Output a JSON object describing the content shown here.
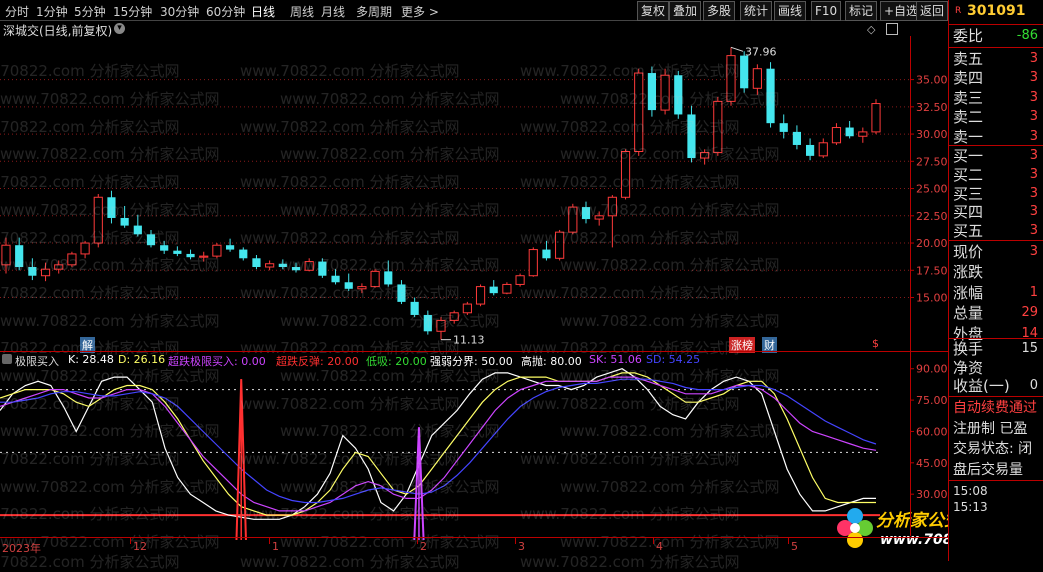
{
  "toolbar": {
    "periods": [
      "分时",
      "1分钟",
      "5分钟",
      "15分钟",
      "30分钟",
      "60分钟",
      "日线",
      "周线",
      "月线",
      "多周期",
      "更多 >"
    ],
    "active": "日线",
    "right_buttons": [
      "复权",
      "叠加",
      "多股",
      "统计",
      "画线",
      "F10",
      "标记",
      "+自选",
      "返回"
    ]
  },
  "stock": {
    "title": "深城交(日线,前复权)",
    "code": "301091",
    "high_label": "37.96",
    "low_label": "11.13",
    "tags": [
      "解",
      "涨榜",
      "财",
      "$"
    ]
  },
  "right_panel": {
    "wei_bi": {
      "label": "委比",
      "value": "-86"
    },
    "sell": [
      {
        "label": "卖五",
        "value": "3"
      },
      {
        "label": "卖四",
        "value": "3"
      },
      {
        "label": "卖三",
        "value": "3"
      },
      {
        "label": "卖二",
        "value": "3"
      },
      {
        "label": "卖一",
        "value": "3"
      }
    ],
    "buy": [
      {
        "label": "买一",
        "value": "3"
      },
      {
        "label": "买二",
        "value": "3"
      },
      {
        "label": "买三",
        "value": "3"
      },
      {
        "label": "买四",
        "value": "3"
      },
      {
        "label": "买五",
        "value": "3"
      }
    ],
    "quote": [
      {
        "label": "现价",
        "value": "3"
      },
      {
        "label": "涨跌",
        "value": ""
      },
      {
        "label": "涨幅",
        "value": "1"
      },
      {
        "label": "总量",
        "value": "29"
      },
      {
        "label": "外盘",
        "value": "14"
      }
    ],
    "extra": [
      {
        "label": "换手",
        "value": "15"
      },
      {
        "label": "净资",
        "value": ""
      },
      {
        "label": "收益(一)",
        "value": "0"
      }
    ],
    "notice": [
      "自动续费通过",
      "注册制 已盈",
      "交易状态: 闭",
      "盘后交易量"
    ],
    "times": [
      "15:08",
      "15:13"
    ]
  },
  "indicator": {
    "name": "极限买入",
    "values": [
      {
        "label": "K: 28.48",
        "color": "#ffffff"
      },
      {
        "label": "D: 26.16",
        "color": "#ffff66"
      },
      {
        "label": "超跌极限买入: 0.00",
        "color": "#cc44ff"
      },
      {
        "label": "超跌反弹: 20.00",
        "color": "#ff3030"
      },
      {
        "label": "低吸: 20.00",
        "color": "#33dd33"
      },
      {
        "label": "强弱分界: 50.00",
        "color": "#ffffff"
      },
      {
        "label": "高抛: 80.00",
        "color": "#ffffff"
      },
      {
        "label": "SK: 51.06",
        "color": "#cc44ff"
      },
      {
        "label": "SD: 54.25",
        "color": "#4444ff"
      }
    ]
  },
  "chart_data": [
    {
      "type": "candlestick",
      "title": "深城交(日线,前复权)",
      "y_ticks": [
        "35.00",
        "32.50",
        "30.00",
        "27.50",
        "25.00",
        "22.50",
        "20.00",
        "17.50",
        "15.00"
      ],
      "ylim": [
        10.0,
        39.0
      ],
      "annotations": [
        {
          "text": "37.96",
          "value": 37.96
        },
        {
          "text": "11.13",
          "value": 11.13
        }
      ],
      "ohlc": [
        [
          18.0,
          20.5,
          17.2,
          19.8
        ],
        [
          19.8,
          20.5,
          17.5,
          17.8
        ],
        [
          17.8,
          18.6,
          16.6,
          17.0
        ],
        [
          17.0,
          18.2,
          16.5,
          17.6
        ],
        [
          17.6,
          18.4,
          17.2,
          18.0
        ],
        [
          18.0,
          19.2,
          17.8,
          19.0
        ],
        [
          19.0,
          20.2,
          18.6,
          20.0
        ],
        [
          20.0,
          24.5,
          19.6,
          24.2
        ],
        [
          24.2,
          24.8,
          21.8,
          22.3
        ],
        [
          22.3,
          23.4,
          21.4,
          21.6
        ],
        [
          21.6,
          22.6,
          20.6,
          20.8
        ],
        [
          20.8,
          21.2,
          19.6,
          19.8
        ],
        [
          19.8,
          20.2,
          19.0,
          19.3
        ],
        [
          19.3,
          19.7,
          18.8,
          19.0
        ],
        [
          19.0,
          19.4,
          18.5,
          18.7
        ],
        [
          18.7,
          19.2,
          18.3,
          18.8
        ],
        [
          18.8,
          20.0,
          18.6,
          19.8
        ],
        [
          19.8,
          20.4,
          19.2,
          19.4
        ],
        [
          19.4,
          19.6,
          18.4,
          18.6
        ],
        [
          18.6,
          18.9,
          17.6,
          17.8
        ],
        [
          17.8,
          18.4,
          17.5,
          18.1
        ],
        [
          18.1,
          18.5,
          17.6,
          17.8
        ],
        [
          17.8,
          18.2,
          17.3,
          17.5
        ],
        [
          17.5,
          18.6,
          17.4,
          18.3
        ],
        [
          18.3,
          18.6,
          16.8,
          17.0
        ],
        [
          17.0,
          17.6,
          16.2,
          16.4
        ],
        [
          16.4,
          17.2,
          15.6,
          15.8
        ],
        [
          15.8,
          16.3,
          15.4,
          16.0
        ],
        [
          16.0,
          17.6,
          15.9,
          17.4
        ],
        [
          17.4,
          18.4,
          16.0,
          16.2
        ],
        [
          16.2,
          16.6,
          14.4,
          14.6
        ],
        [
          14.6,
          15.0,
          13.2,
          13.4
        ],
        [
          13.4,
          13.8,
          11.6,
          11.9
        ],
        [
          11.9,
          13.2,
          11.13,
          12.9
        ],
        [
          12.9,
          13.8,
          12.6,
          13.6
        ],
        [
          13.6,
          14.6,
          13.4,
          14.4
        ],
        [
          14.4,
          16.2,
          14.2,
          16.0
        ],
        [
          16.0,
          16.6,
          15.2,
          15.4
        ],
        [
          15.4,
          16.4,
          15.3,
          16.2
        ],
        [
          16.2,
          17.2,
          16.0,
          17.0
        ],
        [
          17.0,
          19.6,
          16.9,
          19.4
        ],
        [
          19.4,
          20.2,
          18.4,
          18.6
        ],
        [
          18.6,
          21.2,
          18.4,
          21.0
        ],
        [
          21.0,
          23.6,
          20.8,
          23.3
        ],
        [
          23.3,
          23.8,
          21.8,
          22.2
        ],
        [
          22.2,
          22.9,
          21.6,
          22.5
        ],
        [
          22.5,
          24.4,
          19.6,
          24.2
        ],
        [
          24.2,
          28.6,
          24.0,
          28.4
        ],
        [
          28.4,
          36.0,
          28.0,
          35.6
        ],
        [
          35.6,
          36.2,
          31.6,
          32.2
        ],
        [
          32.2,
          36.0,
          31.8,
          35.4
        ],
        [
          35.4,
          35.8,
          31.4,
          31.8
        ],
        [
          31.8,
          32.6,
          27.4,
          27.8
        ],
        [
          27.8,
          28.6,
          27.2,
          28.3
        ],
        [
          28.3,
          33.4,
          28.0,
          33.0
        ],
        [
          33.0,
          37.96,
          32.6,
          37.2
        ],
        [
          37.2,
          37.6,
          33.8,
          34.2
        ],
        [
          34.2,
          36.4,
          33.6,
          36.0
        ],
        [
          36.0,
          36.6,
          30.6,
          31.0
        ],
        [
          31.0,
          31.8,
          29.6,
          30.2
        ],
        [
          30.2,
          30.8,
          28.6,
          29.0
        ],
        [
          29.0,
          29.6,
          27.6,
          28.0
        ],
        [
          28.0,
          29.6,
          27.8,
          29.2
        ],
        [
          29.2,
          31.0,
          29.0,
          30.6
        ],
        [
          30.6,
          31.2,
          29.6,
          29.8
        ],
        [
          29.8,
          30.6,
          29.2,
          30.2
        ],
        [
          30.2,
          33.2,
          30.0,
          32.8
        ]
      ],
      "date_labels": [
        "2023年",
        "12",
        "1",
        "2",
        "3",
        "4",
        "5"
      ]
    },
    {
      "type": "line",
      "title": "极限买入",
      "y_ticks": [
        "90.00",
        "75.00",
        "60.00",
        "45.00",
        "30.00"
      ],
      "ylim": [
        10,
        98
      ],
      "levels": [
        {
          "name": "高抛",
          "value": 80
        },
        {
          "name": "强弱分界",
          "value": 50
        },
        {
          "name": "超跌反弹",
          "value": 20
        }
      ],
      "series": [
        {
          "name": "K",
          "color": "#ffffff",
          "values": [
            70,
            78,
            82,
            84,
            82,
            72,
            60,
            72,
            84,
            86,
            86,
            80,
            74,
            52,
            38,
            30,
            26,
            22,
            20,
            19,
            18,
            18,
            18,
            20,
            24,
            30,
            40,
            58,
            52,
            42,
            26,
            22,
            30,
            44,
            58,
            64,
            70,
            78,
            85,
            88,
            88,
            86,
            84,
            82,
            82,
            80,
            82,
            86,
            88,
            90,
            86,
            80,
            72,
            68,
            66,
            74,
            80,
            84,
            86,
            84,
            78,
            60,
            42,
            30,
            22,
            22,
            24,
            26,
            28,
            28
          ]
        },
        {
          "name": "D",
          "color": "#ffff66",
          "values": [
            76,
            78,
            80,
            80,
            80,
            78,
            74,
            72,
            76,
            80,
            82,
            82,
            80,
            74,
            66,
            56,
            46,
            38,
            30,
            24,
            22,
            20,
            20,
            20,
            22,
            26,
            32,
            42,
            50,
            48,
            40,
            32,
            30,
            34,
            42,
            50,
            58,
            66,
            74,
            80,
            84,
            86,
            86,
            86,
            84,
            84,
            84,
            84,
            86,
            88,
            88,
            86,
            82,
            78,
            74,
            74,
            76,
            78,
            82,
            84,
            84,
            78,
            66,
            52,
            38,
            28,
            26,
            26,
            26,
            26
          ]
        },
        {
          "name": "SK",
          "color": "#cc44ff",
          "values": [
            72,
            74,
            76,
            78,
            80,
            80,
            78,
            76,
            76,
            78,
            80,
            80,
            78,
            72,
            64,
            56,
            48,
            42,
            36,
            30,
            26,
            24,
            22,
            22,
            22,
            24,
            26,
            30,
            34,
            36,
            34,
            30,
            28,
            28,
            32,
            38,
            46,
            54,
            62,
            70,
            76,
            80,
            82,
            84,
            84,
            84,
            84,
            84,
            86,
            86,
            86,
            84,
            82,
            80,
            78,
            78,
            78,
            80,
            82,
            82,
            80,
            76,
            70,
            64,
            60,
            58,
            56,
            54,
            52,
            51
          ]
        },
        {
          "name": "SD",
          "color": "#4444ff",
          "values": [
            74,
            74,
            75,
            76,
            78,
            79,
            79,
            78,
            77,
            77,
            78,
            79,
            78,
            76,
            72,
            66,
            60,
            54,
            48,
            42,
            37,
            32,
            29,
            27,
            26,
            26,
            27,
            28,
            30,
            32,
            33,
            32,
            31,
            30,
            31,
            34,
            39,
            45,
            52,
            59,
            66,
            72,
            76,
            79,
            81,
            82,
            83,
            83,
            84,
            85,
            85,
            85,
            84,
            83,
            81,
            80,
            80,
            80,
            81,
            82,
            82,
            80,
            77,
            73,
            69,
            65,
            62,
            59,
            56,
            54
          ]
        },
        {
          "name": "超跌极限买入",
          "color": "#cc44ff",
          "values": [
            0,
            0,
            0,
            0,
            0,
            0,
            0,
            0,
            0,
            0,
            0,
            0,
            0,
            0,
            0,
            0,
            0,
            0,
            0,
            0,
            0,
            0,
            0,
            0,
            0,
            0,
            0,
            0,
            0,
            0,
            0,
            0,
            0,
            40,
            0,
            0,
            0,
            0,
            0,
            0,
            0,
            0,
            0,
            0,
            0,
            0,
            0,
            0,
            0,
            0,
            0,
            0,
            0,
            0,
            0,
            0,
            0,
            0,
            0,
            0,
            0,
            0,
            0,
            0,
            0,
            0,
            0,
            0,
            0,
            0
          ]
        },
        {
          "name": "超跌反弹",
          "color": "#ff3030",
          "values": [
            0,
            0,
            0,
            0,
            0,
            0,
            0,
            0,
            0,
            0,
            0,
            0,
            0,
            0,
            0,
            0,
            0,
            0,
            0,
            20,
            0,
            0,
            0,
            0,
            0,
            0,
            0,
            0,
            0,
            0,
            0,
            0,
            0,
            0,
            0,
            0,
            0,
            0,
            0,
            0,
            0,
            0,
            0,
            0,
            0,
            0,
            0,
            0,
            0,
            0,
            0,
            0,
            0,
            0,
            0,
            0,
            0,
            0,
            0,
            0,
            0,
            0,
            0,
            0,
            0,
            0,
            0,
            0,
            0,
            0
          ]
        }
      ]
    }
  ],
  "watermark": {
    "texts": [
      "www.70822.com 分析家公式网",
      "www.70822.com"
    ]
  },
  "logo": {
    "name": "分析家公式网",
    "url": "www.70822.com"
  }
}
